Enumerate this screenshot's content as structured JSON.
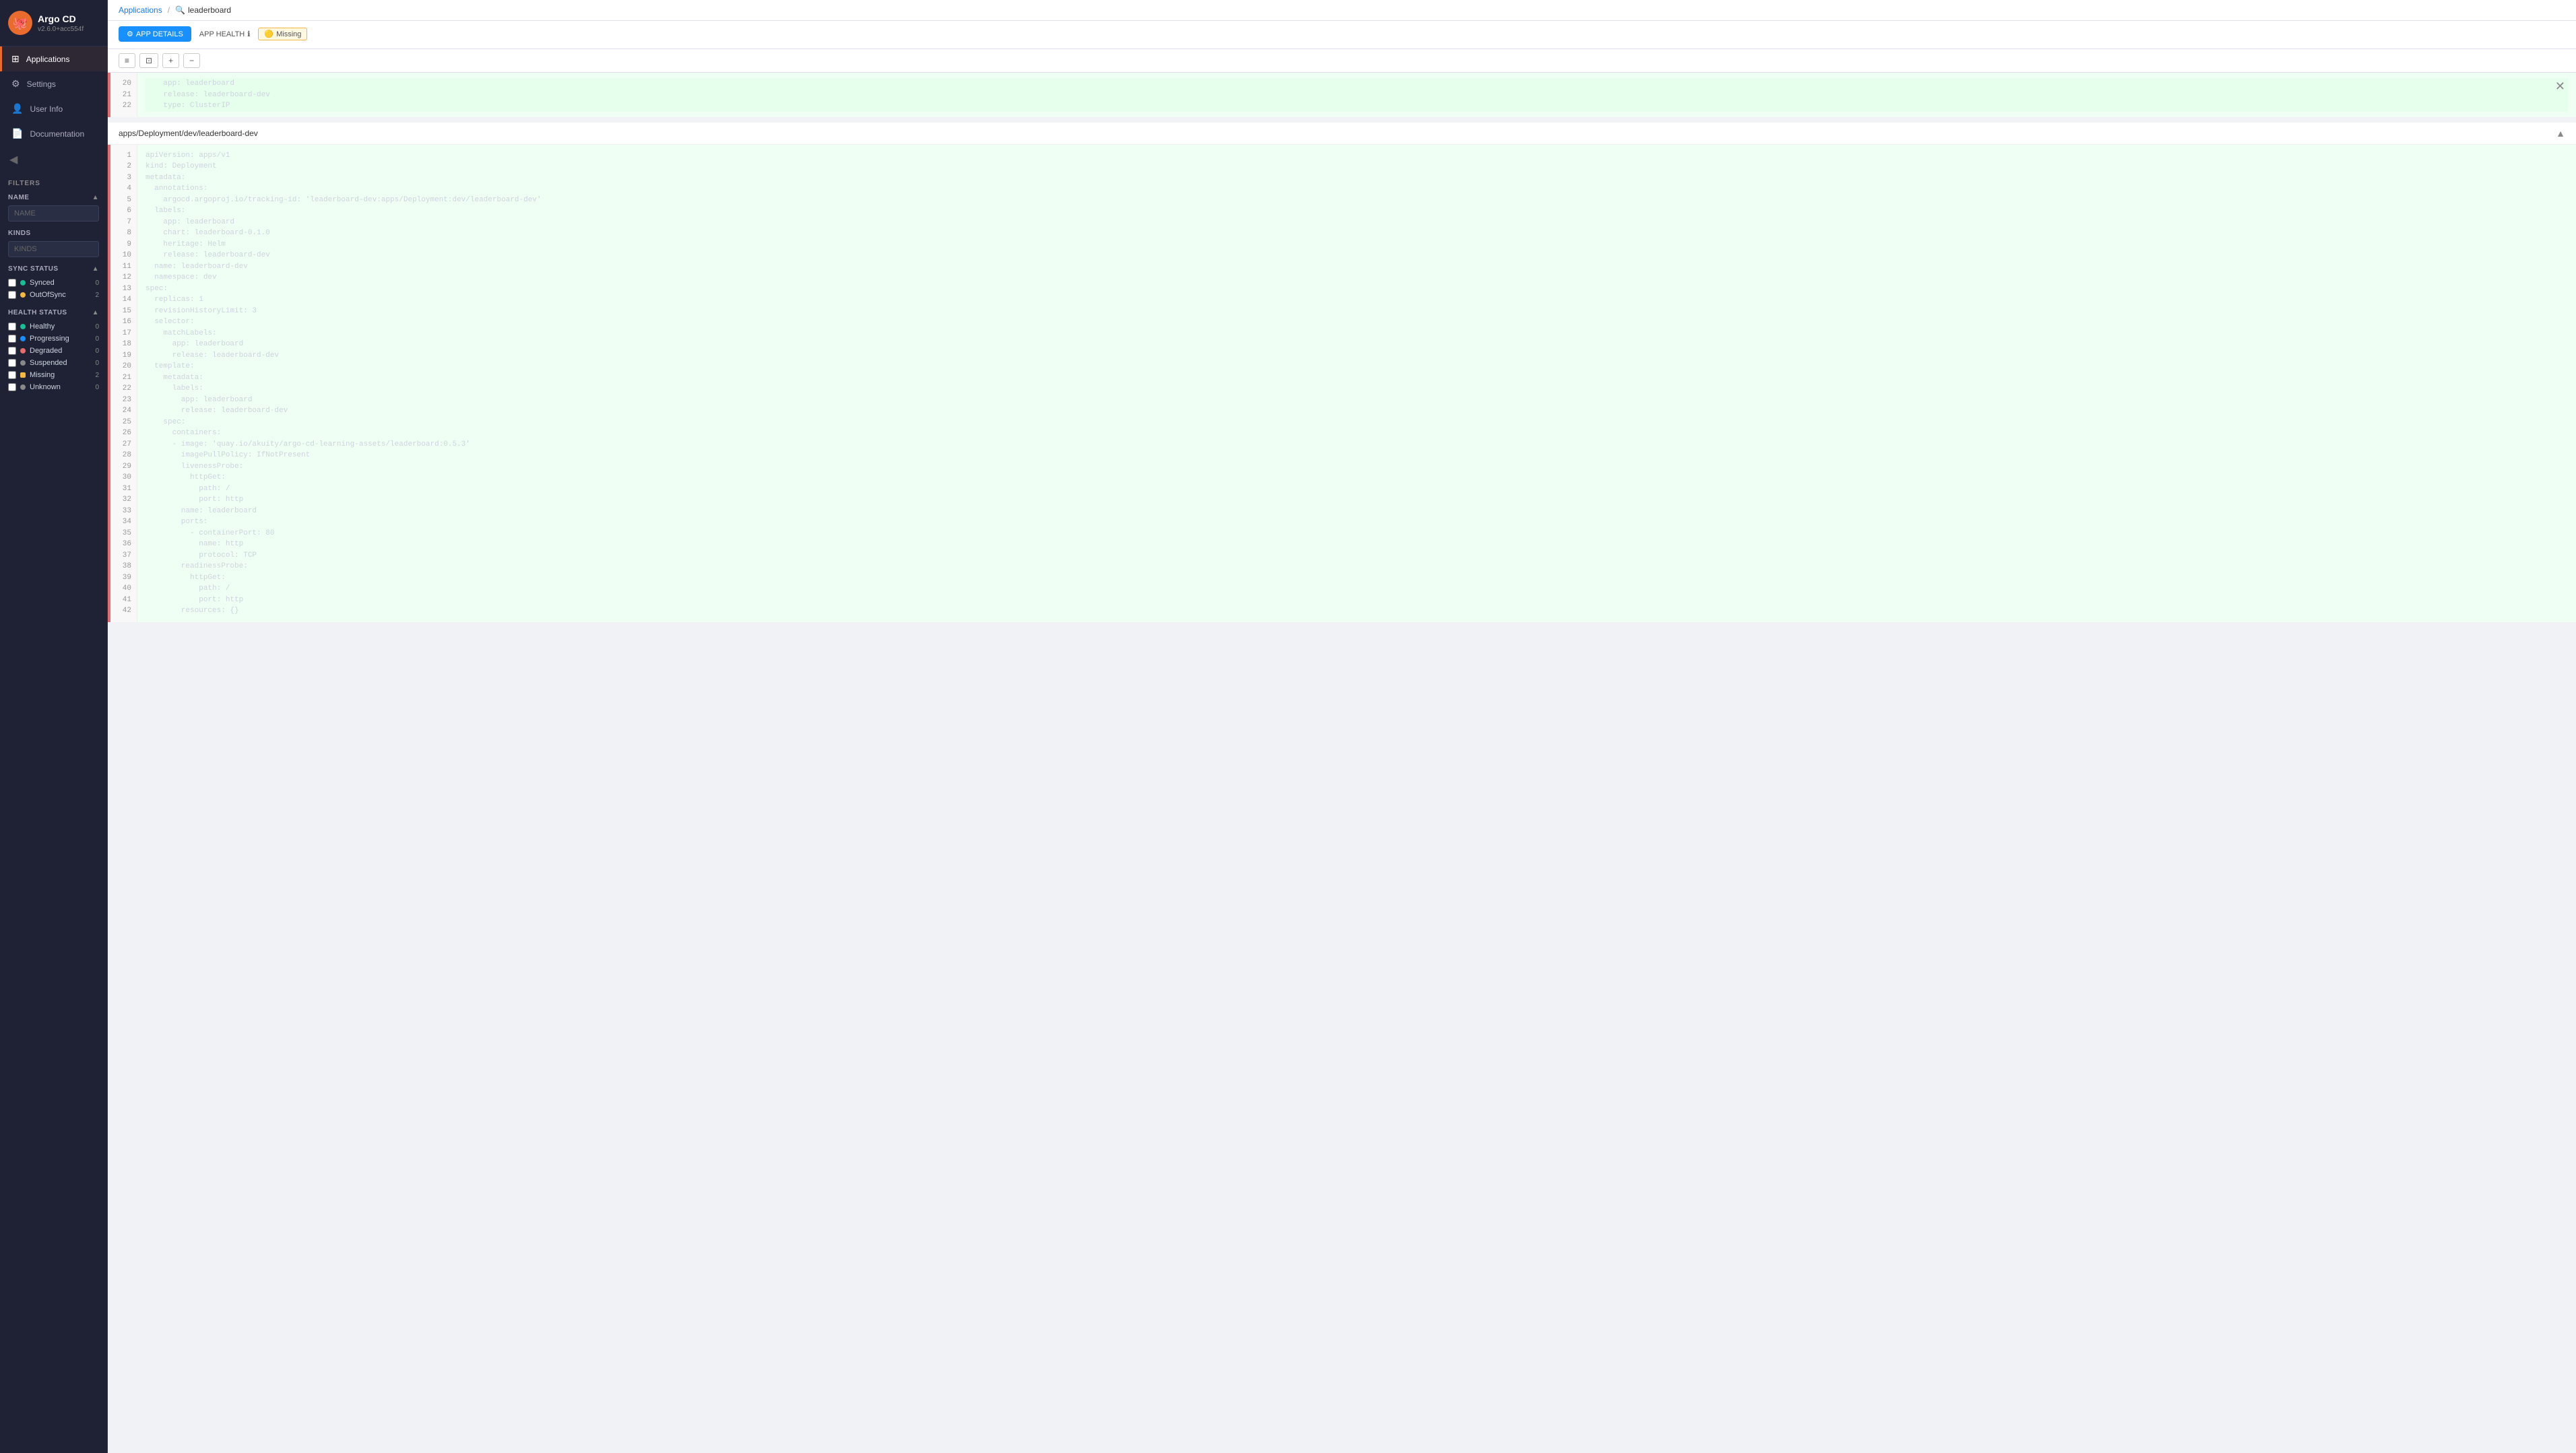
{
  "app": {
    "title": "Argo CD",
    "version": "v2.6.0+acc554f",
    "logo_emoji": "🐙"
  },
  "nav": {
    "items": [
      {
        "id": "applications",
        "label": "Applications",
        "icon": "⊞",
        "active": true
      },
      {
        "id": "settings",
        "label": "Settings",
        "icon": "⚙",
        "active": false
      },
      {
        "id": "userinfo",
        "label": "User Info",
        "icon": "👤",
        "active": false
      },
      {
        "id": "documentation",
        "label": "Documentation",
        "icon": "📄",
        "active": false
      }
    ]
  },
  "filters": {
    "title": "FILTERS",
    "name": {
      "label": "NAME",
      "placeholder": "NAME",
      "value": ""
    },
    "kinds": {
      "label": "KINDS",
      "placeholder": "KINDS",
      "value": ""
    },
    "sync_status": {
      "label": "SYNC STATUS",
      "items": [
        {
          "id": "synced",
          "label": "Synced",
          "color": "green",
          "count": 0
        },
        {
          "id": "outofsync",
          "label": "OutOfSync",
          "color": "yellow",
          "count": 2
        }
      ]
    },
    "health_status": {
      "label": "HEALTH STATUS",
      "items": [
        {
          "id": "healthy",
          "label": "Healthy",
          "color": "green",
          "count": 0
        },
        {
          "id": "progressing",
          "label": "Progressing",
          "color": "blue",
          "count": 0
        },
        {
          "id": "degraded",
          "label": "Degraded",
          "color": "red",
          "count": 0
        },
        {
          "id": "suspended",
          "label": "Suspended",
          "color": "grey",
          "count": 0
        },
        {
          "id": "missing",
          "label": "Missing",
          "color": "yellow",
          "count": 2
        },
        {
          "id": "unknown",
          "label": "Unknown",
          "color": "grey",
          "count": 0
        }
      ]
    }
  },
  "breadcrumb": {
    "parent": "Applications",
    "separator": "/",
    "current": "leaderboard",
    "search_icon": "🔍"
  },
  "app_detail": {
    "btn_label": "APP DETAILS",
    "btn_icon": "⚙",
    "health_label": "APP HEALTH",
    "health_info_icon": "ℹ",
    "status": "Missing",
    "status_icon": "🟡"
  },
  "toolbar": {
    "buttons": [
      "≡",
      "⊡",
      "+",
      "−"
    ]
  },
  "panels": [
    {
      "id": "panel-service",
      "path": "",
      "collapsed": true,
      "lines_before": [
        {
          "num": 20,
          "text": "    app: leaderboard",
          "type": "added"
        },
        {
          "num": 21,
          "text": "    release: leaderboard-dev",
          "type": "added"
        },
        {
          "num": 22,
          "text": "    type: ClusterIP",
          "type": "added"
        }
      ]
    },
    {
      "id": "panel-deployment",
      "path": "apps/Deployment/dev/leaderboard-dev",
      "collapsed": false,
      "code_lines": [
        {
          "num": 1,
          "text": "apiVersion: apps/v1"
        },
        {
          "num": 2,
          "text": "kind: Deployment"
        },
        {
          "num": 3,
          "text": "metadata:"
        },
        {
          "num": 4,
          "text": "  annotations:"
        },
        {
          "num": 5,
          "text": "    argocd.argoproj.io/tracking-id: 'leaderboard-dev:apps/Deployment:dev/leaderboard-dev'"
        },
        {
          "num": 6,
          "text": "  labels:"
        },
        {
          "num": 7,
          "text": "    app: leaderboard"
        },
        {
          "num": 8,
          "text": "    chart: leaderboard-0.1.0"
        },
        {
          "num": 9,
          "text": "    heritage: Helm"
        },
        {
          "num": 10,
          "text": "    release: leaderboard-dev"
        },
        {
          "num": 11,
          "text": "  name: leaderboard-dev"
        },
        {
          "num": 12,
          "text": "  namespace: dev"
        },
        {
          "num": 13,
          "text": "spec:"
        },
        {
          "num": 14,
          "text": "  replicas: 1"
        },
        {
          "num": 15,
          "text": "  revisionHistoryLimit: 3"
        },
        {
          "num": 16,
          "text": "  selector:"
        },
        {
          "num": 17,
          "text": "    matchLabels:"
        },
        {
          "num": 18,
          "text": "      app: leaderboard"
        },
        {
          "num": 19,
          "text": "      release: leaderboard-dev"
        },
        {
          "num": 20,
          "text": "  template:"
        },
        {
          "num": 21,
          "text": "    metadata:"
        },
        {
          "num": 22,
          "text": "      labels:"
        },
        {
          "num": 23,
          "text": "        app: leaderboard"
        },
        {
          "num": 24,
          "text": "        release: leaderboard-dev"
        },
        {
          "num": 25,
          "text": "    spec:"
        },
        {
          "num": 26,
          "text": "      containers:"
        },
        {
          "num": 27,
          "text": "      - image: 'quay.io/akuity/argo-cd-learning-assets/leaderboard:0.5.3'"
        },
        {
          "num": 28,
          "text": "        imagePullPolicy: IfNotPresent"
        },
        {
          "num": 29,
          "text": "        livenessProbe:"
        },
        {
          "num": 30,
          "text": "          httpGet:"
        },
        {
          "num": 31,
          "text": "            path: /"
        },
        {
          "num": 32,
          "text": "            port: http"
        },
        {
          "num": 33,
          "text": "        name: leaderboard"
        },
        {
          "num": 34,
          "text": "        ports:"
        },
        {
          "num": 35,
          "text": "          - containerPort: 80"
        },
        {
          "num": 36,
          "text": "            name: http"
        },
        {
          "num": 37,
          "text": "            protocol: TCP"
        },
        {
          "num": 38,
          "text": "        readinessProbe:"
        },
        {
          "num": 39,
          "text": "          httpGet:"
        },
        {
          "num": 40,
          "text": "            path: /"
        },
        {
          "num": 41,
          "text": "            port: http"
        },
        {
          "num": 42,
          "text": "        resources: {}"
        }
      ]
    }
  ]
}
